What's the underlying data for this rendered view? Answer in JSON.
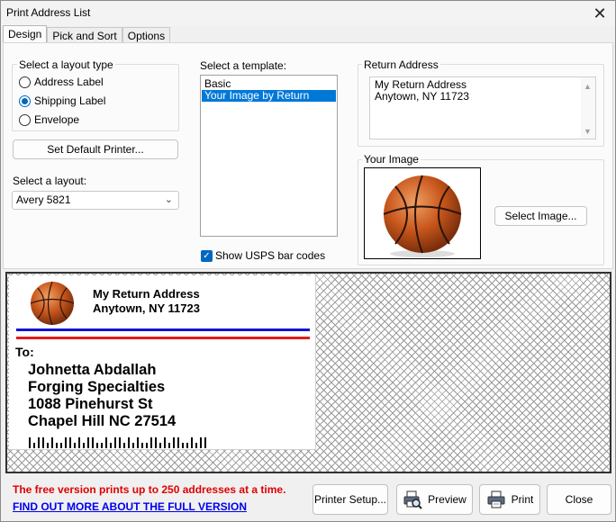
{
  "window": {
    "title": "Print Address List",
    "close_glyph": "✕"
  },
  "tabs": [
    {
      "label": "Design"
    },
    {
      "label": "Pick and Sort"
    },
    {
      "label": "Options"
    }
  ],
  "layout_type": {
    "label": "Select a layout type",
    "options": [
      {
        "label": "Address Label"
      },
      {
        "label": "Shipping Label"
      },
      {
        "label": "Envelope"
      }
    ],
    "selected": "Shipping Label"
  },
  "set_default_printer_label": "Set Default Printer...",
  "layout": {
    "label": "Select a layout:",
    "value": "Avery 5821"
  },
  "template": {
    "label": "Select a template:",
    "items": [
      {
        "label": "Basic"
      },
      {
        "label": "Your Image  by Return"
      }
    ],
    "selected": "Your Image  by Return"
  },
  "usps": {
    "label": "Show USPS bar codes",
    "checked": true
  },
  "return_address": {
    "label": "Return Address",
    "lines": [
      "My Return Address",
      "Anytown, NY 11723"
    ]
  },
  "your_image": {
    "label": "Your Image",
    "select_button": "Select Image...",
    "icon": "basketball-icon"
  },
  "preview": {
    "return_lines": [
      "My Return Address",
      "Anytown, NY 11723"
    ],
    "to_label": "To:",
    "recipient_lines": [
      "Johnetta Abdallah",
      "Forging Specialties",
      "1088 Pinehurst St",
      "Chapel Hill NC 27514"
    ],
    "stripe_colors": {
      "top": "#1313d6",
      "bottom": "#e21b1b"
    }
  },
  "footer": {
    "notice": "The free version prints up to 250 addresses at a time.",
    "link": "FIND OUT MORE ABOUT THE FULL VERSION",
    "buttons": {
      "printer_setup": "Printer Setup...",
      "preview": "Preview",
      "print": "Print",
      "close": "Close"
    }
  },
  "colors": {
    "accent": "#0078d7",
    "notice": "#e00000",
    "link": "#0000ee"
  }
}
